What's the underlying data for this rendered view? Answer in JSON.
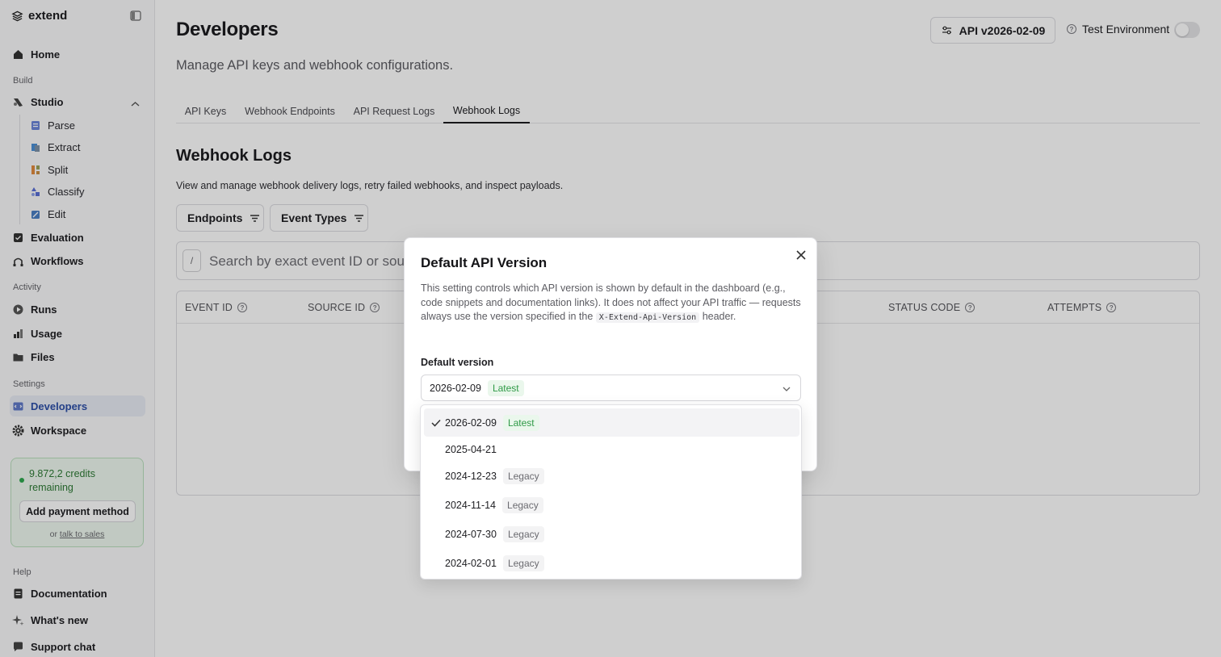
{
  "app": {
    "name": "extend"
  },
  "sidebar": {
    "home": "Home",
    "build_label": "Build",
    "studio": "Studio",
    "studio_items": [
      "Parse",
      "Extract",
      "Split",
      "Classify",
      "Edit"
    ],
    "evaluation": "Evaluation",
    "workflows": "Workflows",
    "activity_label": "Activity",
    "runs": "Runs",
    "usage": "Usage",
    "files": "Files",
    "settings_label": "Settings",
    "developers": "Developers",
    "workspace": "Workspace",
    "credits_text": "9.872,2 credits remaining",
    "add_payment": "Add payment method",
    "or_text": "or",
    "talk_to_sales": "talk to sales",
    "help_label": "Help",
    "documentation": "Documentation",
    "whats_new": "What's new",
    "support_chat": "Support chat"
  },
  "header": {
    "title": "Developers",
    "subtitle": "Manage API keys and webhook configurations.",
    "api_version_button": "API v2026-02-09",
    "test_environment": "Test Environment",
    "test_environment_on": false
  },
  "tabs": [
    {
      "label": "API Keys",
      "active": false
    },
    {
      "label": "Webhook Endpoints",
      "active": false
    },
    {
      "label": "API Request Logs",
      "active": false
    },
    {
      "label": "Webhook Logs",
      "active": true
    }
  ],
  "section": {
    "title": "Webhook Logs",
    "description": "View and manage webhook delivery logs, retry failed webhooks, and inspect payloads."
  },
  "filters": {
    "endpoints": "Endpoints",
    "event_types": "Event Types"
  },
  "search": {
    "shortcut": "/",
    "placeholder": "Search by exact event ID or source ID"
  },
  "table": {
    "columns": [
      "EVENT ID",
      "SOURCE ID",
      "STATUS CODE",
      "ATTEMPTS"
    ]
  },
  "modal": {
    "title": "Default API Version",
    "description_before": "This setting controls which API version is shown by default in the dashboard (e.g., code snippets and documentation links). It does not affect your API traffic — requests always use the version specified in the",
    "header_code": "X-Extend-Api-Version",
    "description_after": "header.",
    "field_label": "Default version",
    "selected_version": "2026-02-09",
    "selected_badge": "Latest"
  },
  "version_options": [
    {
      "version": "2026-02-09",
      "badge": "Latest",
      "badge_type": "latest",
      "selected": true
    },
    {
      "version": "2025-04-21",
      "badge": "",
      "badge_type": "none",
      "selected": false
    },
    {
      "version": "2024-12-23",
      "badge": "Legacy",
      "badge_type": "legacy",
      "selected": false
    },
    {
      "version": "2024-11-14",
      "badge": "Legacy",
      "badge_type": "legacy",
      "selected": false
    },
    {
      "version": "2024-07-30",
      "badge": "Legacy",
      "badge_type": "legacy",
      "selected": false
    },
    {
      "version": "2024-02-01",
      "badge": "Legacy",
      "badge_type": "legacy",
      "selected": false
    }
  ],
  "colors": {
    "accent": "#2d4fa8",
    "latest": "#2f9a47",
    "credits": "#2e7a35"
  }
}
